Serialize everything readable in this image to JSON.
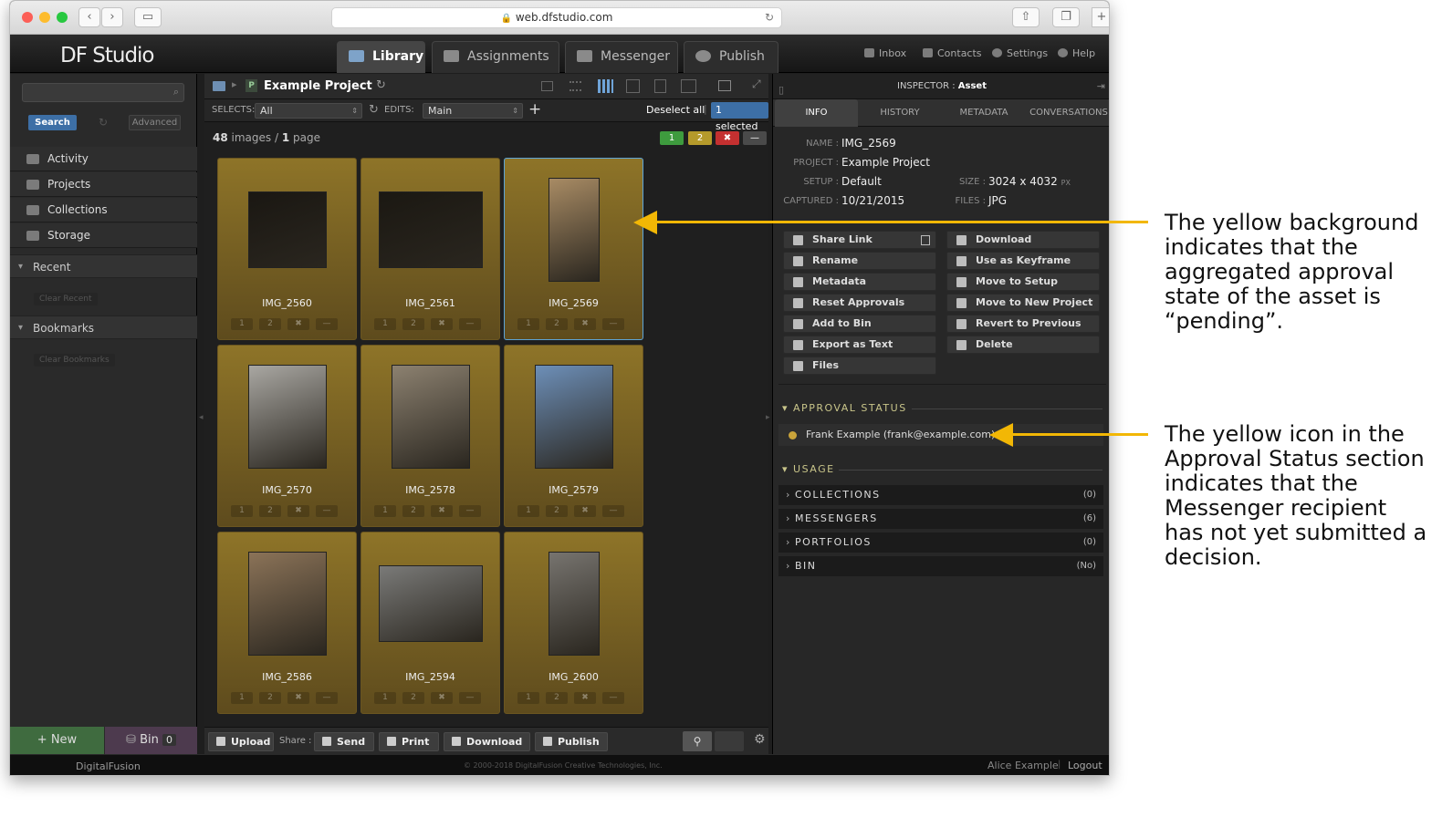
{
  "browser": {
    "url": "web.dfstudio.com"
  },
  "app": {
    "logo": "DF Studio"
  },
  "tabs": [
    {
      "label": "Library",
      "active": true
    },
    {
      "label": "Assignments"
    },
    {
      "label": "Messenger"
    },
    {
      "label": "Publish"
    }
  ],
  "header_links": {
    "inbox": "Inbox",
    "contacts": "Contacts",
    "settings": "Settings",
    "help": "Help"
  },
  "sidebar": {
    "search_button": "Search",
    "advanced_button": "Advanced",
    "items": [
      {
        "label": "Activity",
        "icon": "activity-icon"
      },
      {
        "label": "Projects",
        "icon": "projects-icon"
      },
      {
        "label": "Collections",
        "icon": "collections-icon"
      },
      {
        "label": "Storage",
        "icon": "storage-icon"
      }
    ],
    "recent": "Recent",
    "clear_recent": "Clear Recent",
    "bookmarks": "Bookmarks",
    "clear_bookmarks": "Clear Bookmarks",
    "new_button": "+ New",
    "bin_label": "Bin",
    "bin_count": "0"
  },
  "library": {
    "project_badge": "P",
    "project_title": "Example Project",
    "selects_label": "SELECTS:",
    "selects_value": "All",
    "edits_label": "EDITS:",
    "edits_value": "Main",
    "deselect_all": "Deselect all",
    "separator": "|",
    "selected_badge": "1 selected",
    "image_count": "48",
    "images_word": "images /",
    "page_count": "1",
    "page_word": "page",
    "filter_boxes": [
      "1",
      "2",
      "✖",
      "—"
    ],
    "thumb_buttons": [
      "1",
      "2",
      "✖",
      "—"
    ],
    "thumbnails": [
      {
        "name": "IMG_2560"
      },
      {
        "name": "IMG_2561"
      },
      {
        "name": "IMG_2569",
        "selected": true
      },
      {
        "name": "IMG_2570"
      },
      {
        "name": "IMG_2578"
      },
      {
        "name": "IMG_2579"
      },
      {
        "name": "IMG_2586"
      },
      {
        "name": "IMG_2594"
      },
      {
        "name": "IMG_2600"
      }
    ],
    "bottom_upload": "Upload",
    "bottom_share_label": "Share :",
    "bottom_send": "Send",
    "bottom_print": "Print",
    "bottom_download": "Download",
    "bottom_publish": "Publish"
  },
  "inspector": {
    "heading": "INSPECTOR :",
    "heading_value": "Asset",
    "tabs": [
      "INFO",
      "HISTORY",
      "METADATA",
      "CONVERSATIONS"
    ],
    "name_label": "NAME :",
    "name": "IMG_2569",
    "project_label": "PROJECT :",
    "project": "Example Project",
    "setup_label": "SETUP :",
    "setup": "Default",
    "captured_label": "CAPTURED :",
    "captured": "10/21/2015",
    "size_label": "SIZE :",
    "size": "3024 x 4032",
    "size_unit": "PX",
    "files_label": "FILES :",
    "files": "JPG",
    "actions_left": [
      "Share Link",
      "Rename",
      "Metadata",
      "Reset Approvals",
      "Add to Bin",
      "Export as Text",
      "Files"
    ],
    "actions_right": [
      "Download",
      "Use as Keyframe",
      "Move to Setup",
      "Move to New Project",
      "Revert to Previous",
      "Delete"
    ],
    "approval_heading": "APPROVAL STATUS",
    "approval_user": "Frank Example (frank@example.com)",
    "usage_heading": "USAGE",
    "usage": [
      {
        "label": "COLLECTIONS",
        "count": "(0)"
      },
      {
        "label": "MESSENGERS",
        "count": "(6)"
      },
      {
        "label": "PORTFOLIOS",
        "count": "(0)"
      },
      {
        "label": "BIN",
        "count": "(No)"
      }
    ]
  },
  "footer": {
    "brand": "DigitalFusion",
    "copyright": "© 2000-2018 DigitalFusion Creative Technologies, Inc.",
    "user": "Alice Example",
    "separator": "|",
    "logout": "Logout"
  },
  "annotations": {
    "callout1": "The yellow background indicates that the aggregated approval state of the asset is “pending”.",
    "callout2": "The yellow icon in the Approval Status section indicates that the Messenger recipient has not yet submitted a decision."
  },
  "colors": {
    "pending_yellow": "#c9a33a",
    "arrow": "#f2b705",
    "accent_blue": "#3d6fa6"
  }
}
